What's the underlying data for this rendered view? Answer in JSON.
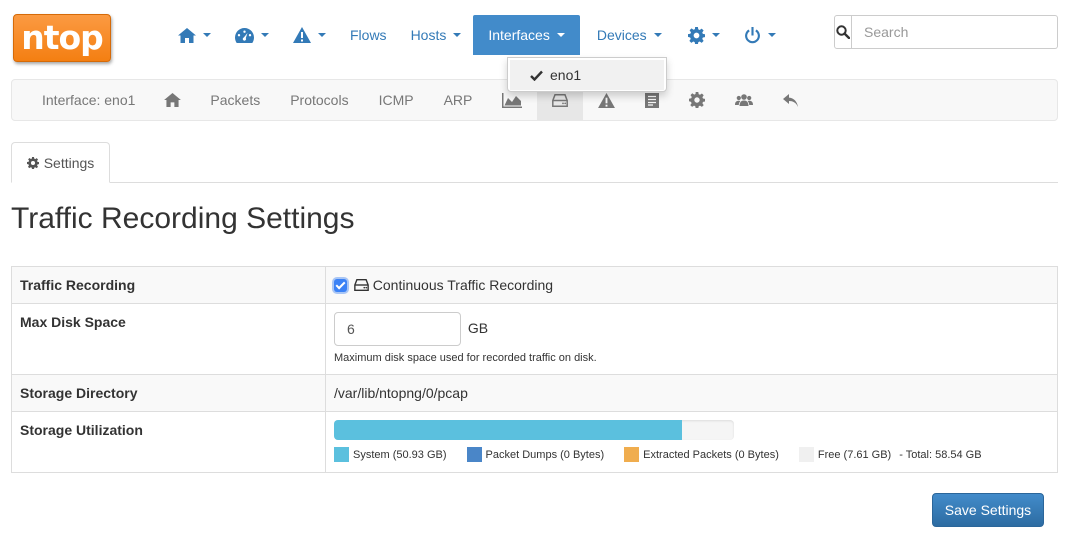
{
  "logo": {
    "text": "ntop"
  },
  "topnav": {
    "items": [
      {
        "label": "",
        "icon": "home-icon"
      },
      {
        "label": "",
        "icon": "dashboard-icon"
      },
      {
        "label": "",
        "icon": "alert-icon"
      },
      {
        "label": "Flows"
      },
      {
        "label": "Hosts"
      },
      {
        "label": "Interfaces",
        "active": true
      },
      {
        "label": "Devices"
      },
      {
        "label": "",
        "icon": "gear-icon"
      },
      {
        "label": "",
        "icon": "power-icon"
      }
    ],
    "search_placeholder": "Search"
  },
  "interfaces_dropdown": {
    "items": [
      {
        "label": "eno1",
        "checked": true
      }
    ]
  },
  "subnav": {
    "interface_label": "Interface: eno1",
    "items": [
      {
        "label": "Packets"
      },
      {
        "label": "Protocols"
      },
      {
        "label": "ICMP"
      },
      {
        "label": "ARP"
      }
    ]
  },
  "tabs": [
    {
      "label": "Settings",
      "icon": "gear-icon"
    }
  ],
  "page_title": "Traffic Recording Settings",
  "settings": {
    "traffic_recording": {
      "label": "Traffic Recording",
      "checkbox_label": "Continuous Traffic Recording",
      "checked": true
    },
    "max_disk_space": {
      "label": "Max Disk Space",
      "value": "6",
      "unit": "GB",
      "hint": "Maximum disk space used for recorded traffic on disk."
    },
    "storage_directory": {
      "label": "Storage Directory",
      "value": "/var/lib/ntopng/0/pcap"
    },
    "storage_utilization": {
      "label": "Storage Utilization",
      "total_label": "-  Total: 58.54 GB",
      "segments": [
        {
          "label": "System (50.93 GB)",
          "color": "#5bc0de",
          "fraction": 0.87
        },
        {
          "label": "Packet Dumps (0 Bytes)",
          "color": "#4a86c8",
          "fraction": 0
        },
        {
          "label": "Extracted Packets (0 Bytes)",
          "color": "#f0ad4e",
          "fraction": 0
        },
        {
          "label": "Free (7.61 GB)",
          "color": "#f0f0f0",
          "fraction": 0.13
        }
      ]
    }
  },
  "save_button": {
    "label": "Save Settings"
  },
  "colors": {
    "link": "#337ab7",
    "active_nav": "#428bca",
    "logo": "#f48a1e"
  }
}
